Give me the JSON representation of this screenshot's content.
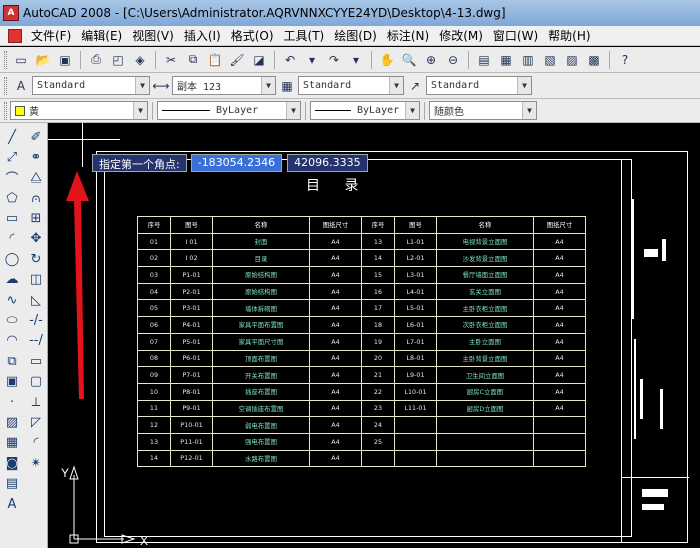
{
  "window": {
    "app_name": "AutoCAD 2008",
    "title": "AutoCAD 2008 - [C:\\Users\\Administrator.AQRVNNXCYYE24YD\\Desktop\\4-13.dwg]",
    "icon_label": "A"
  },
  "menu": [
    "文件(F)",
    "编辑(E)",
    "视图(V)",
    "插入(I)",
    "格式(O)",
    "工具(T)",
    "绘图(D)",
    "标注(N)",
    "修改(M)",
    "窗口(W)",
    "帮助(H)"
  ],
  "styles_toolbar": {
    "text_style": "Standard",
    "dim_style": "副本 123",
    "table_style": "Standard",
    "multileader_style": "Standard"
  },
  "properties_toolbar": {
    "layer": "黄",
    "linetype": "ByLayer",
    "lineweight": "ByLayer",
    "plot_color": "随颜色",
    "layer_color": "#ffff00"
  },
  "dynamic_input": {
    "prompt": "指定第一个角点:",
    "x_value": "-183054.2346",
    "y_value": "42096.3335"
  },
  "drawing": {
    "title": "目  录",
    "headers": [
      "序号",
      "图号",
      "名称",
      "图纸尺寸",
      "序号",
      "图号",
      "名称",
      "图纸尺寸"
    ],
    "rows": [
      [
        "01",
        "I 01",
        "封面",
        "A4",
        "13",
        "L1-01",
        "电视背景立面图",
        "A4"
      ],
      [
        "02",
        "I 02",
        "目录",
        "A4",
        "14",
        "L2-01",
        "沙发背景立面图",
        "A4"
      ],
      [
        "03",
        "P1-01",
        "原始结构图",
        "A4",
        "15",
        "L3-01",
        "餐厅墙面立面图",
        "A4"
      ],
      [
        "04",
        "P2-01",
        "原始结构图",
        "A4",
        "16",
        "L4-01",
        "玄关立面图",
        "A4"
      ],
      [
        "05",
        "P3-01",
        "墙体拆砌图",
        "A4",
        "17",
        "L5-01",
        "主卧衣柜立面图",
        "A4"
      ],
      [
        "06",
        "P4-01",
        "家具平面布置图",
        "A4",
        "18",
        "L6-01",
        "次卧衣柜立面图",
        "A4"
      ],
      [
        "07",
        "P5-01",
        "家具平面尺寸图",
        "A4",
        "19",
        "L7-01",
        "主卧立面图",
        "A4"
      ],
      [
        "08",
        "P6-01",
        "顶面布置图",
        "A4",
        "20",
        "L8-01",
        "主卧背景立面图",
        "A4"
      ],
      [
        "09",
        "P7-01",
        "开关布置图",
        "A4",
        "21",
        "L9-01",
        "卫生间立面图",
        "A4"
      ],
      [
        "10",
        "P8-01",
        "插座布置图",
        "A4",
        "22",
        "L10-01",
        "厨房C立面图",
        "A4"
      ],
      [
        "11",
        "P9-01",
        "空调插座布置图",
        "A4",
        "23",
        "L11-01",
        "厨房D立面图",
        "A4"
      ],
      [
        "12",
        "P10-01",
        "弱电布置图",
        "A4",
        "24",
        "",
        "",
        ""
      ],
      [
        "13",
        "P11-01",
        "强电布置图",
        "A4",
        "25",
        "",
        "",
        ""
      ],
      [
        "14",
        "P12-01",
        "水路布置图",
        "A4",
        "",
        "",
        "",
        ""
      ]
    ]
  },
  "ucs": {
    "x_label": "X",
    "y_label": "Y"
  },
  "annotation_color": "#e0141a"
}
